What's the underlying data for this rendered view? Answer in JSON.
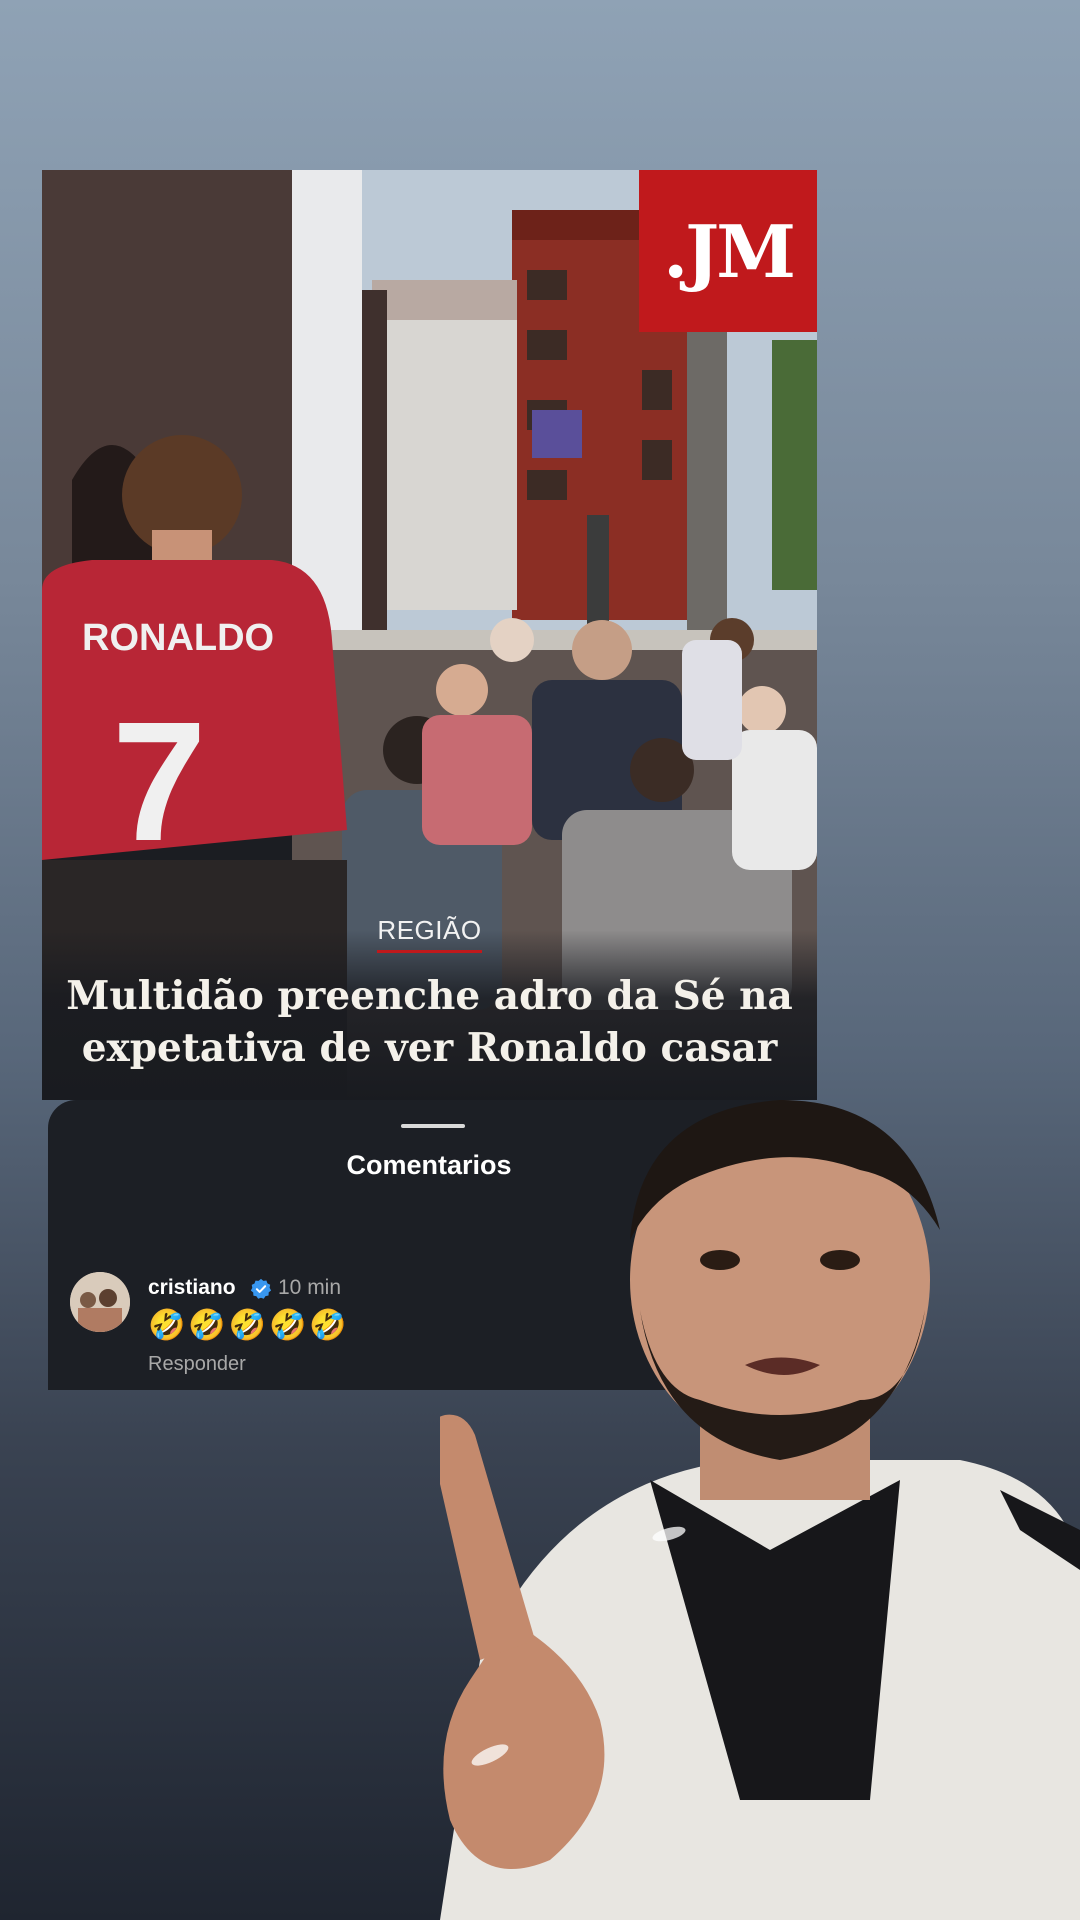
{
  "news": {
    "logo_text": ".JM",
    "category": "REGIÃO",
    "headline": "Multidão preenche adro da Sé na expetativa de ver Ronaldo casar",
    "photo_jersey_name": "RONALDO",
    "photo_jersey_number": "7"
  },
  "comments": {
    "title": "Comentarios",
    "items": [
      {
        "username": "cristiano",
        "verified": true,
        "time": "10 min",
        "text": "🤣🤣🤣🤣🤣",
        "reply_label": "Responder"
      }
    ]
  },
  "colors": {
    "brand_red": "#c0191c",
    "panel_bg": "#1c1f25",
    "verified_blue": "#3897f0",
    "jersey_red": "#b82636"
  }
}
